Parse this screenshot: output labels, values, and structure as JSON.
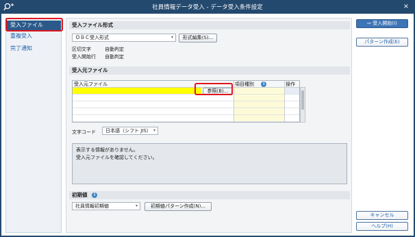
{
  "window": {
    "title": "社員情報データ受入 - データ受入条件設定",
    "close_label": "×"
  },
  "nav": {
    "items": [
      {
        "label": "受入ファイル",
        "active": true
      },
      {
        "label": "重複受入",
        "active": false
      },
      {
        "label": "完了通知",
        "active": false
      }
    ]
  },
  "format_section": {
    "title": "受入ファイル形式",
    "format_value": "ＯＢＣ受入形式",
    "edit_button": "形式編集(S)...",
    "rows": [
      {
        "label": "区切文字",
        "value": "自動判定"
      },
      {
        "label": "受入開始行",
        "value": "自動判定"
      }
    ]
  },
  "source_section": {
    "title": "受入元ファイル",
    "columns": [
      "受入元ファイル",
      "項目種別",
      "操作"
    ],
    "browse_button": "参照(B)...",
    "encoding_label": "文字コード",
    "encoding_value": "日本語（シフト JIS）",
    "message_lines": [
      "表示する情報がありません。",
      "受入元ファイルを確認してください。"
    ]
  },
  "initial_section": {
    "title": "初期値",
    "value": "社員情報初期値",
    "pattern_button": "初期値パターン作成(N)..."
  },
  "side_buttons": {
    "start": "受入開始(I)",
    "pattern": "パターン作成(E)",
    "cancel": "キャンセル",
    "help": "ヘルプ(H)"
  },
  "colors": {
    "title_bar": "#24496e",
    "nav_active": "#2b5a8a",
    "highlight": "#e0141e",
    "selected_cell": "#ffff00"
  }
}
